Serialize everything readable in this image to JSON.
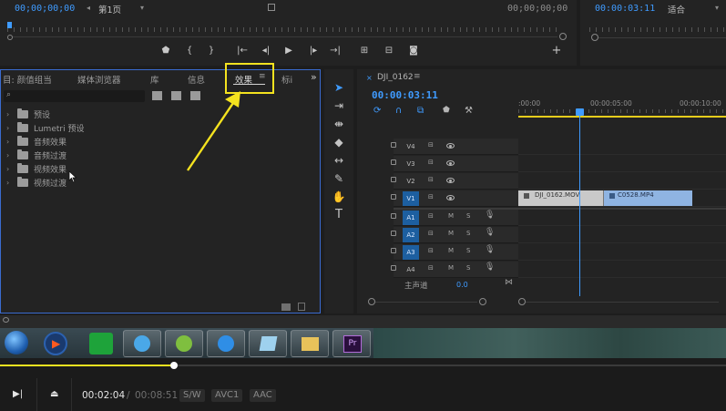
{
  "source_monitor": {
    "timecode_in": "00;00;00;00",
    "page_select": "第1页",
    "timecode_out": "00;00;00;00"
  },
  "program_monitor": {
    "timecode": "00:00:03:11",
    "fit_select": "适合"
  },
  "effects_panel": {
    "tabs": [
      "目: 颜值组当",
      "媒体浏览器",
      "库",
      "信息",
      "效果",
      "标i"
    ],
    "active_tab": "效果",
    "overflow": "»",
    "search_placeholder": "",
    "tree": [
      {
        "label": "预设",
        "icon": "preset-folder-icon"
      },
      {
        "label": "Lumetri 预设",
        "icon": "preset-folder-icon"
      },
      {
        "label": "音频效果",
        "icon": "folder-icon"
      },
      {
        "label": "音频过渡",
        "icon": "folder-icon"
      },
      {
        "label": "视频效果",
        "icon": "folder-icon"
      },
      {
        "label": "视频过渡",
        "icon": "folder-icon"
      }
    ]
  },
  "timeline": {
    "sequence_name": "DJI_0162",
    "timecode": "00:00:03:11",
    "ruler_labels": [
      ":00:00",
      "00:00:05:00",
      "00:00:10:00"
    ],
    "video_tracks": [
      "V4",
      "V3",
      "V2",
      "V1"
    ],
    "audio_tracks": [
      "A1",
      "A2",
      "A3",
      "A4"
    ],
    "mute_label": "M",
    "solo_label": "S",
    "master_label": "主声道",
    "master_value": "0.0",
    "clips": [
      {
        "name": "DJI_0162.MOV",
        "track": "V1",
        "color": "#c9c9c9"
      },
      {
        "name": "C0528.MP4",
        "track": "V1",
        "color": "#8fb4e2"
      }
    ]
  },
  "player": {
    "current_time": "00:02:04",
    "separator": "/",
    "total_time": "00:08:51",
    "progress": 0.24,
    "badges": [
      "S/W",
      "AVC1",
      "AAC"
    ]
  },
  "colors": {
    "accent_blue": "#3f9bff",
    "highlight_yellow": "#f4e21f",
    "panel_border": "#3a6bd0",
    "player_progress": "#f4e21f"
  }
}
